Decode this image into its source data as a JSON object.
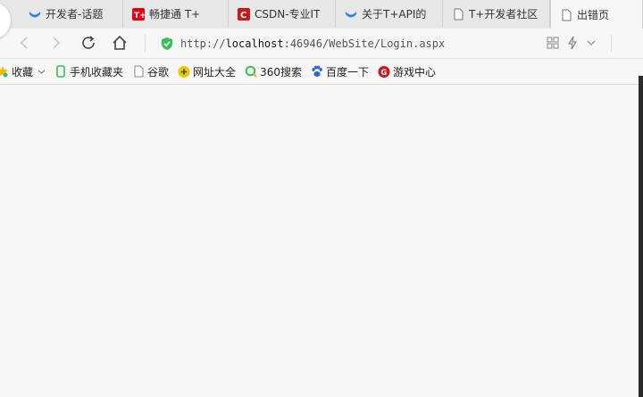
{
  "tabs": [
    {
      "label": "开发者-话题",
      "icon": "bird-icon",
      "color": "#2b88d8"
    },
    {
      "label": "畅捷通 T+",
      "icon": "tplus-icon",
      "color": "#e60012"
    },
    {
      "label": "CSDN-专业IT",
      "icon": "csdn-icon",
      "color": "#c9181e"
    },
    {
      "label": "关于T+API的",
      "icon": "bird-icon",
      "color": "#2b88d8"
    },
    {
      "label": "T+开发者社区",
      "icon": "page-icon",
      "color": "#777777"
    },
    {
      "label": "出错页",
      "icon": "page-icon",
      "color": "#777777"
    }
  ],
  "address": {
    "prefix": "http://",
    "host": "localhost",
    "rest": ":46946/WebSite/Login.aspx"
  },
  "bookmarks": [
    {
      "label": "收藏",
      "icon": "star-icon"
    },
    {
      "label": "手机收藏夹",
      "icon": "phone-icon"
    },
    {
      "label": "谷歌",
      "icon": "page-icon"
    },
    {
      "label": "网址大全",
      "icon": "globe-icon"
    },
    {
      "label": "360搜索",
      "icon": "search360-icon"
    },
    {
      "label": "百度一下",
      "icon": "baidu-paw-icon"
    },
    {
      "label": "游戏中心",
      "icon": "game-icon"
    }
  ],
  "colors": {
    "secure": "#3cbf58",
    "accent": "#2b88d8"
  }
}
